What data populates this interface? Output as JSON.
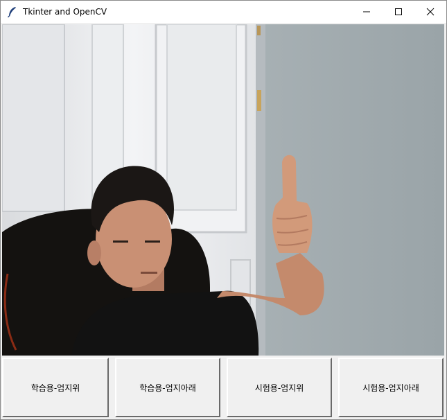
{
  "window": {
    "title": "Tkinter and OpenCV",
    "app_icon": "feather-icon",
    "controls": [
      "minimize-icon",
      "maximize-icon",
      "close-icon"
    ]
  },
  "video": {
    "subject": "webcam-frame-person-thumbs-up"
  },
  "buttons": [
    {
      "label": "학습용-엄지위"
    },
    {
      "label": "학습용-엄지아래"
    },
    {
      "label": "시험용-엄지위"
    },
    {
      "label": "시험용-엄지아래"
    }
  ],
  "colors": {
    "titlebar_bg": "#ffffff",
    "window_bg": "#f0f0f0",
    "wall": "#a9b2b5",
    "door": "#e6e8ea",
    "shirt": "#121212",
    "skin": "#c99074"
  }
}
